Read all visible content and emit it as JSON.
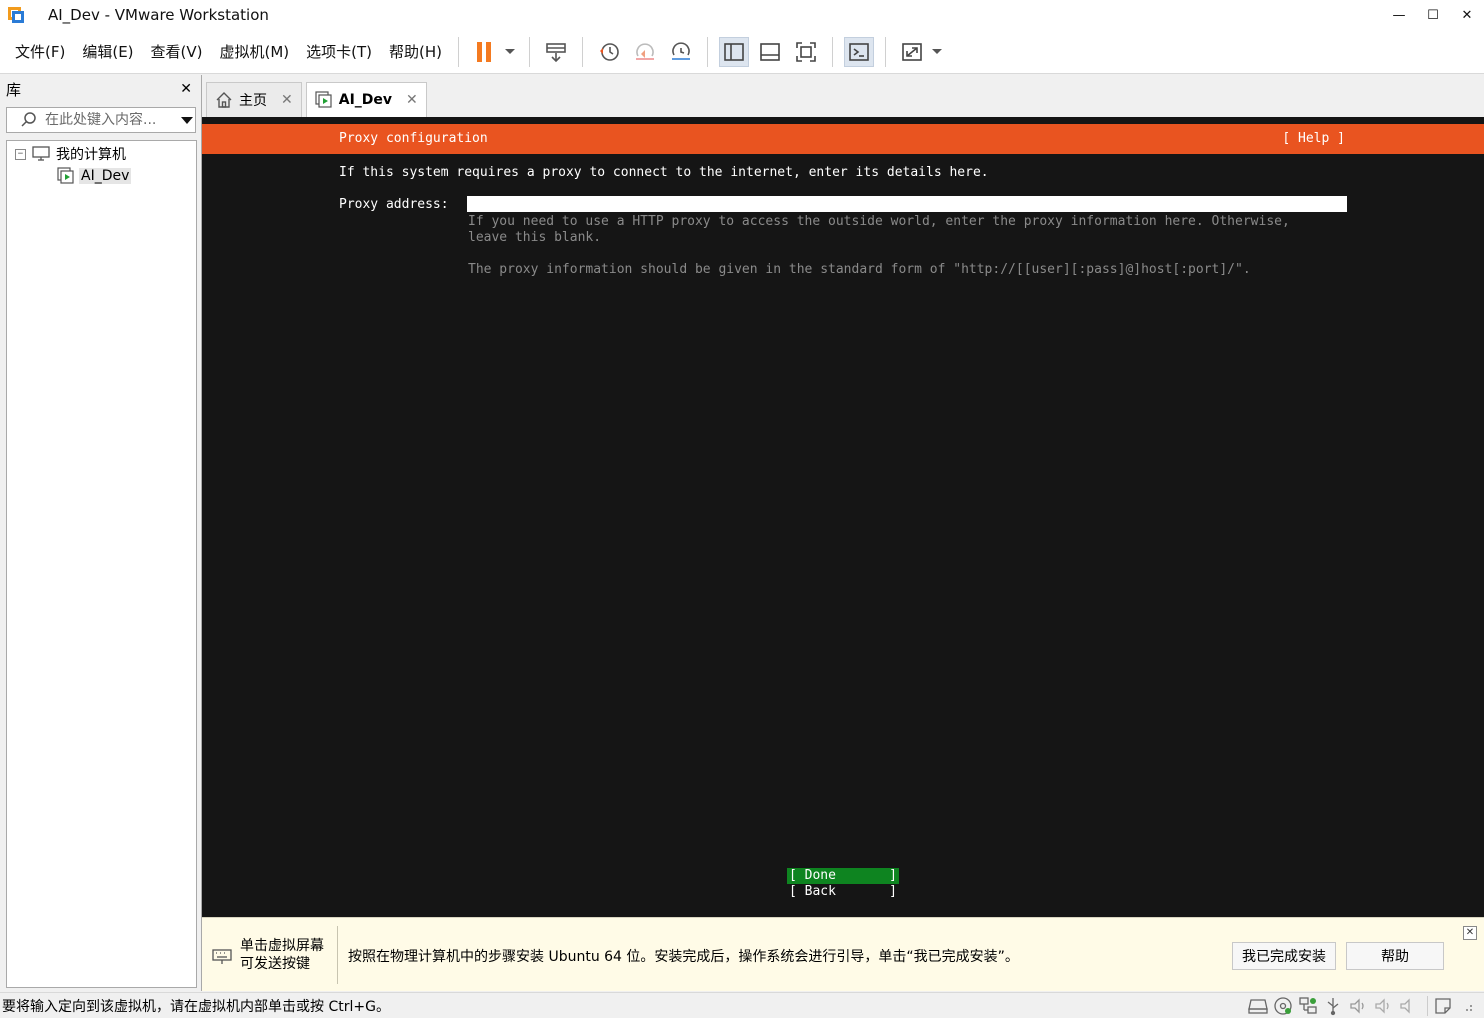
{
  "window": {
    "title": "AI_Dev - VMware Workstation",
    "minimize": "—",
    "maximize": "☐",
    "close": "✕"
  },
  "menu": {
    "items": [
      "文件(F)",
      "编辑(E)",
      "查看(V)",
      "虚拟机(M)",
      "选项卡(T)",
      "帮助(H)"
    ]
  },
  "colors": {
    "ubuntu_orange": "#e95420",
    "done_green": "#0e8420",
    "console_bg": "#151515",
    "pause_orange": "#f47a20"
  },
  "library": {
    "title": "库",
    "close": "✕",
    "search_placeholder": "在此处键入内容...",
    "tree": {
      "root_toggle": "−",
      "root_label": "我的计算机",
      "child_label": "AI_Dev"
    }
  },
  "tabs": [
    {
      "label": "主页",
      "icon": "home-icon",
      "close": "✕"
    },
    {
      "label": "AI_Dev",
      "icon": "vm-icon",
      "close": "✕"
    }
  ],
  "console": {
    "header_title": "Proxy configuration",
    "header_help": "[ Help ]",
    "intro": "If this system requires a proxy to connect to the internet, enter its details here.",
    "proxy_label": "Proxy address:",
    "proxy_value": "",
    "help_text_1": "If you need to use a HTTP proxy to access the outside world, enter the proxy information here. Otherwise, leave this blank.",
    "help_text_2": "The proxy information should be given in the standard form of \"http://[[user][:pass]@]host[:port]/\".",
    "done": {
      "open": "[ Done",
      "close": "]"
    },
    "back": {
      "open": "[ Back",
      "close": "]"
    }
  },
  "hint": {
    "left_line1": "单击虚拟屏幕",
    "left_line2": "可发送按键",
    "message": "按照在物理计算机中的步骤安装 Ubuntu 64 位。安装完成后，操作系统会进行引导，单击“我已完成安装”。",
    "finish_button": "我已完成安装",
    "help_button": "帮助",
    "close": "✕"
  },
  "status": {
    "text": "要将输入定向到该虚拟机，请在虚拟机内部单击或按 Ctrl+G。"
  }
}
